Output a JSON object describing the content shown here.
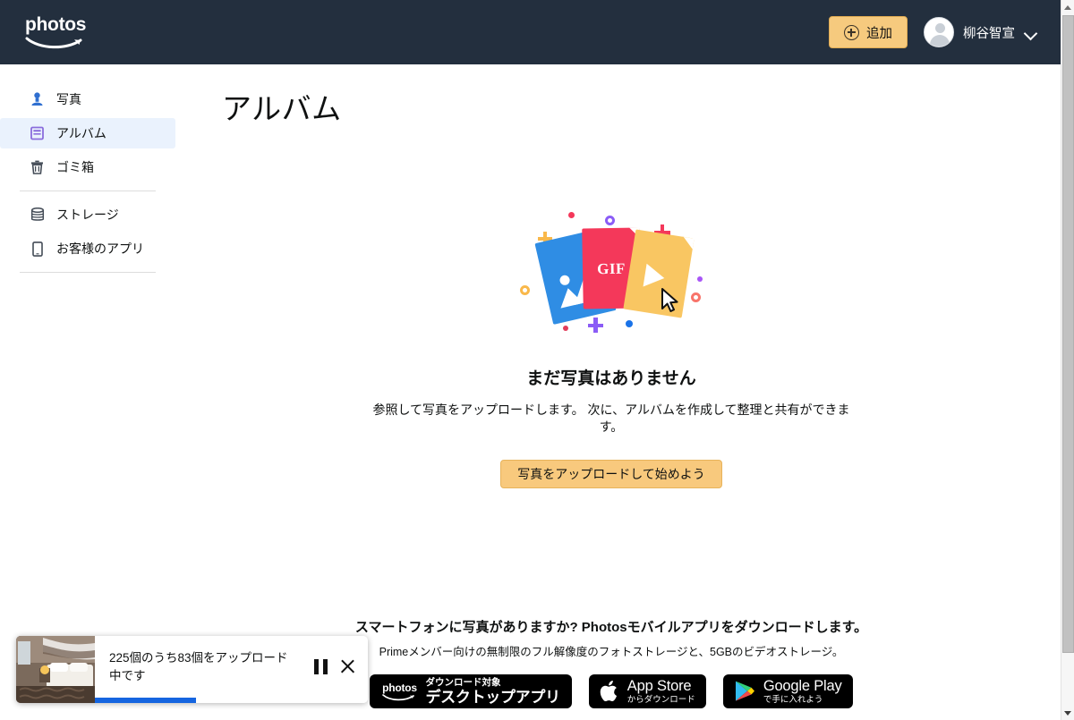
{
  "header": {
    "logo_text": "photos",
    "logo_icon": "amazon-smile-icon",
    "add_button_label": "追加",
    "add_button_icon": "plus-circle-icon",
    "account_name": "柳谷智宣",
    "account_chevron_icon": "chevron-down-icon",
    "avatar_icon": "avatar-person-icon",
    "background_color": "#232f3e",
    "add_button_color": "#f6ca7e"
  },
  "sidebar": {
    "items": [
      {
        "label": "写真",
        "icon": "photo-person-icon",
        "selected": false
      },
      {
        "label": "アルバム",
        "icon": "album-book-icon",
        "selected": true
      },
      {
        "label": "ゴミ箱",
        "icon": "trash-icon",
        "selected": false
      },
      {
        "label": "ストレージ",
        "icon": "storage-stack-icon",
        "selected": false
      },
      {
        "label": "お客様のアプリ",
        "icon": "mobile-device-icon",
        "selected": false
      }
    ],
    "selected_background": "#eaf2fd"
  },
  "main": {
    "page_title": "アルバム",
    "empty_state": {
      "illustration": {
        "cards": [
          {
            "name": "image-card",
            "color": "#2f8de4",
            "glyph": "image-icon"
          },
          {
            "name": "gif-card",
            "color": "#f4385a",
            "glyph": "GIF"
          },
          {
            "name": "video-card",
            "color": "#f9c662",
            "glyph": "play-icon"
          }
        ],
        "cursor_icon": "mouse-cursor-icon",
        "decorations": [
          {
            "name": "dot-red",
            "type": "dot",
            "color": "#f4385a"
          },
          {
            "name": "ring-purple",
            "type": "ring",
            "color": "#8b5cf6"
          },
          {
            "name": "plus-orange",
            "type": "plus",
            "color": "#f9b84a"
          },
          {
            "name": "plus-pink",
            "type": "plus",
            "color": "#f4385a"
          },
          {
            "name": "ring-orange",
            "type": "ring",
            "color": "#f9b84a"
          },
          {
            "name": "dot-purple",
            "type": "dot",
            "color": "#a855f7"
          },
          {
            "name": "ring-salmon",
            "type": "ring",
            "color": "#f8746a"
          },
          {
            "name": "dot-crimson",
            "type": "dot",
            "color": "#e23b5a"
          },
          {
            "name": "plus-violet",
            "type": "plus",
            "color": "#8b5cf6"
          },
          {
            "name": "dot-blue",
            "type": "dot",
            "color": "#1a73e8"
          }
        ]
      },
      "title": "まだ写真はありません",
      "subtitle": "参照して写真をアップロードします。 次に、アルバムを作成して整理と共有ができます。",
      "upload_button_label": "写真をアップロードして始めよう"
    },
    "promo": {
      "title": "スマートフォンに写真がありますか? Photosモバイルアプリをダウンロードします。",
      "subtitle": "Primeメンバー向けの無制限のフル解像度のフォトストレージと、5GBのビデオストレージ。",
      "badges": [
        {
          "name": "desktop-app-badge",
          "logo_text": "photos",
          "line1": "ダウンロード対象",
          "line2": "デスクトップアプリ"
        },
        {
          "name": "app-store-badge",
          "icon": "apple-logo-icon",
          "line1": "App Store",
          "line2": "からダウンロード"
        },
        {
          "name": "google-play-badge",
          "icon": "google-play-triangle-icon",
          "line1": "Google Play",
          "line2": "で手に入れよう"
        }
      ]
    }
  },
  "upload_toast": {
    "thumbnail_alt": "hotel-room-photo",
    "message": "225個のうち83個をアップロード中です",
    "total_count": 225,
    "uploaded_count": 83,
    "progress_percent": 37,
    "pause_icon": "pause-icon",
    "close_icon": "close-icon",
    "progress_color": "#1565e0"
  },
  "scrollbar": {
    "up_arrow_icon": "scroll-up-arrow-icon",
    "down_arrow_icon": "scroll-down-arrow-icon"
  }
}
